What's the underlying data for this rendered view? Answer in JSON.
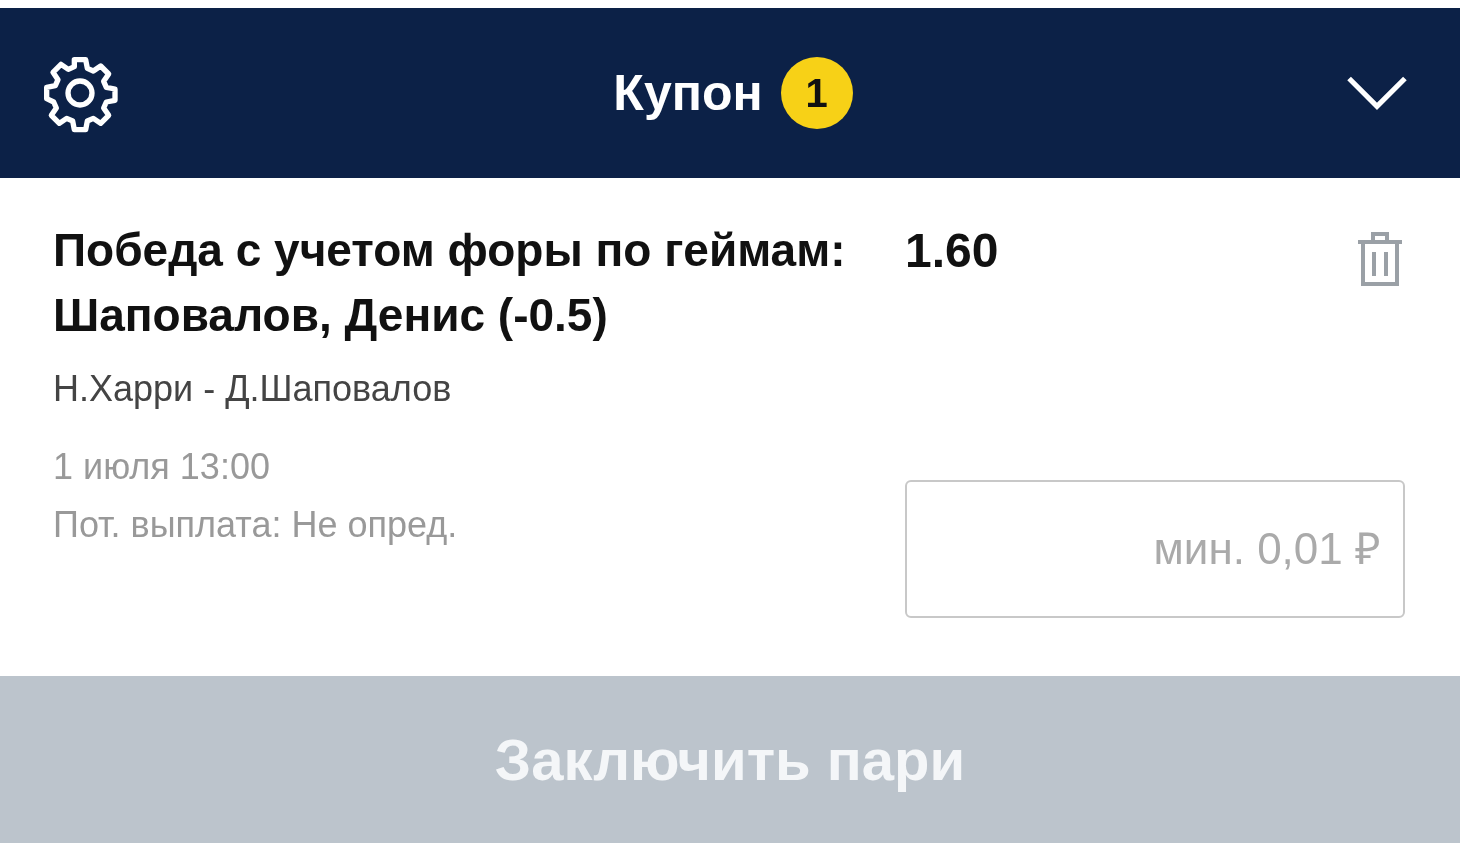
{
  "header": {
    "title": "Купон",
    "badge": "1"
  },
  "bet": {
    "title": "Победа с учетом форы по геймам: Шаповалов, Денис (-0.5)",
    "odds": "1.60",
    "match": "Н.Харри - Д.Шаповалов",
    "date": "1 июля 13:00",
    "payout": "Пот. выплата: Не опред.",
    "stake": {
      "placeholder": "мин. 0,01 ₽"
    }
  },
  "submit": {
    "label": "Заключить пари",
    "disabled": true
  }
}
